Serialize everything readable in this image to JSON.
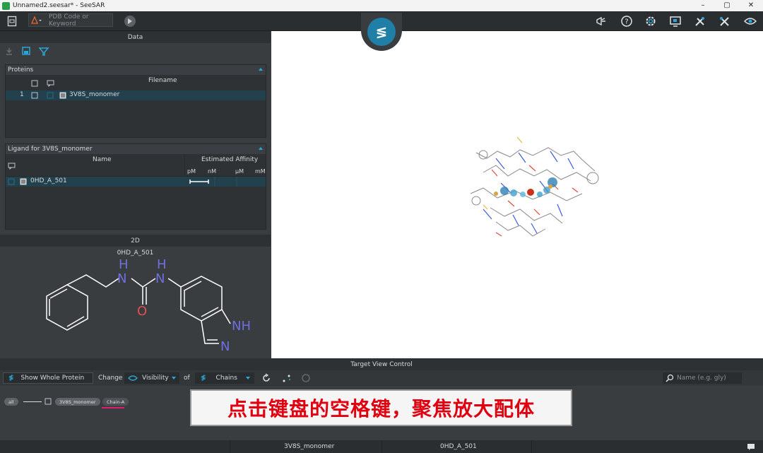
{
  "window": {
    "title": "Unnamed2.seesar* - SeeSAR",
    "min": "–",
    "restore": "▢",
    "close": "✕"
  },
  "toolbar": {
    "search_placeholder": "PDB Code or Keyword"
  },
  "data_panel": {
    "title": "Data"
  },
  "proteins": {
    "title": "Proteins",
    "column_filename": "Filename",
    "rows": [
      {
        "index": "1",
        "filename": "3V8S_monomer"
      }
    ]
  },
  "ligands": {
    "title": "Ligand for 3V8S_monomer",
    "column_name": "Name",
    "column_affinity": "Estimated Affinity",
    "units": [
      "pM",
      "nM",
      "µM",
      "mM"
    ],
    "rows": [
      {
        "name": "0HD_A_501"
      }
    ]
  },
  "view2d": {
    "title": "2D",
    "ligand_label": "0HD_A_501",
    "atoms": {
      "h1": "H",
      "n1": "N",
      "h2": "H",
      "n2": "N",
      "o": "O",
      "nh": "NH",
      "n3": "N"
    }
  },
  "tvc": {
    "title": "Target View Control",
    "show_whole": "Show Whole Protein",
    "change": "Change",
    "visibility": "Visibility",
    "of": "of",
    "chains": "Chains",
    "name_placeholder": "Name (e.g. gly)",
    "pill_all": "all",
    "pill_protein": "3V8S_monomer",
    "pill_chain": "Chain-A"
  },
  "statusbar": {
    "protein": "3V8S_monomer",
    "ligand": "0HD_A_501"
  },
  "caption": {
    "text": "点击键盘的空格键，聚焦放大配体"
  },
  "colors": {
    "accent": "#2aa7d8",
    "selection": "#22414d",
    "caption_red": "#e0000f",
    "atom_blue": "#6f6fe0",
    "atom_red": "#e05050"
  }
}
